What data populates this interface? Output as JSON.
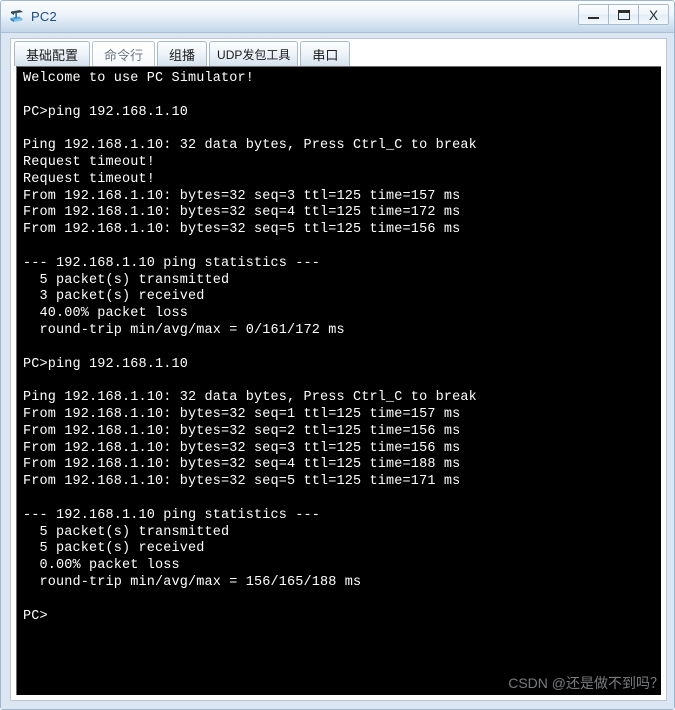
{
  "window": {
    "title": "PC2",
    "icon": "pc-network-icon",
    "controls": [
      {
        "name": "minimize-button",
        "glyph": "_",
        "label": "Minimize"
      },
      {
        "name": "maximize-button",
        "glyph": "□",
        "label": "Maximize"
      },
      {
        "name": "close-button",
        "glyph": "X",
        "label": "Close"
      }
    ]
  },
  "tabs": [
    {
      "id": "basic-config",
      "label": "基础配置",
      "active": false
    },
    {
      "id": "command-line",
      "label": "命令行",
      "active": true
    },
    {
      "id": "multicast",
      "label": "组播",
      "active": false
    },
    {
      "id": "udp-packet-tool",
      "label": "UDP发包工具",
      "active": false
    },
    {
      "id": "serial-port",
      "label": "串口",
      "active": false
    }
  ],
  "terminal": {
    "lines": [
      "Welcome to use PC Simulator!",
      "",
      "PC>ping 192.168.1.10",
      "",
      "Ping 192.168.1.10: 32 data bytes, Press Ctrl_C to break",
      "Request timeout!",
      "Request timeout!",
      "From 192.168.1.10: bytes=32 seq=3 ttl=125 time=157 ms",
      "From 192.168.1.10: bytes=32 seq=4 ttl=125 time=172 ms",
      "From 192.168.1.10: bytes=32 seq=5 ttl=125 time=156 ms",
      "",
      "--- 192.168.1.10 ping statistics ---",
      "  5 packet(s) transmitted",
      "  3 packet(s) received",
      "  40.00% packet loss",
      "  round-trip min/avg/max = 0/161/172 ms",
      "",
      "PC>ping 192.168.1.10",
      "",
      "Ping 192.168.1.10: 32 data bytes, Press Ctrl_C to break",
      "From 192.168.1.10: bytes=32 seq=1 ttl=125 time=157 ms",
      "From 192.168.1.10: bytes=32 seq=2 ttl=125 time=156 ms",
      "From 192.168.1.10: bytes=32 seq=3 ttl=125 time=156 ms",
      "From 192.168.1.10: bytes=32 seq=4 ttl=125 time=188 ms",
      "From 192.168.1.10: bytes=32 seq=5 ttl=125 time=171 ms",
      "",
      "--- 192.168.1.10 ping statistics ---",
      "  5 packet(s) transmitted",
      "  5 packet(s) received",
      "  0.00% packet loss",
      "  round-trip min/avg/max = 156/165/188 ms",
      "",
      "PC>"
    ]
  },
  "watermark": {
    "text": "CSDN @还是做不到吗？"
  },
  "colors": {
    "terminal_bg": "#000000",
    "terminal_fg": "#ffffff",
    "window_bg": "#dce6f2",
    "title_accent": "#1c4b82"
  }
}
